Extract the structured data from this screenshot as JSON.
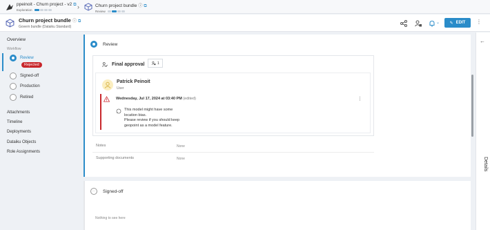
{
  "breadcrumb": {
    "project": {
      "title": "ppeinoit - Churn project - v2",
      "stage": "Exploration"
    },
    "bundle": {
      "title": "Churn project bundle",
      "stage": "Review"
    }
  },
  "header": {
    "title": "Churn project bundle",
    "subtitle": "Govern bundle (Dataiku Standard)",
    "edit_label": "EDIT"
  },
  "sidebar": {
    "overview": "Overview",
    "workflow_label": "Workflow",
    "steps": [
      {
        "label": "Review",
        "status": "Rejected"
      },
      {
        "label": "Signed-off"
      },
      {
        "label": "Production"
      },
      {
        "label": "Retired"
      }
    ],
    "links": [
      "Attachments",
      "Timeline",
      "Deployments",
      "Dataiku Objects",
      "Role Assignments"
    ]
  },
  "main": {
    "review_title": "Review",
    "approval": {
      "title": "Final approval",
      "approver_count": "1",
      "user_name": "Patrick Peinoit",
      "user_role": "User",
      "comment_date": "Wednesday, Jul 17, 2024 at 03:40 PM",
      "comment_edited": "(edited)",
      "comment_text": "This model might have some\nlocation bias.\nPlease review if you should keep\ngeopoint as a model feature."
    },
    "notes_label": "Notes",
    "notes_value": "None",
    "docs_label": "Supporting documents",
    "docs_value": "None",
    "signed_title": "Signed-off",
    "signed_empty": "Nothing to see here"
  },
  "details_label": "Details",
  "colors": {
    "accent": "#2a8cc9",
    "rejected": "#c8262b"
  }
}
